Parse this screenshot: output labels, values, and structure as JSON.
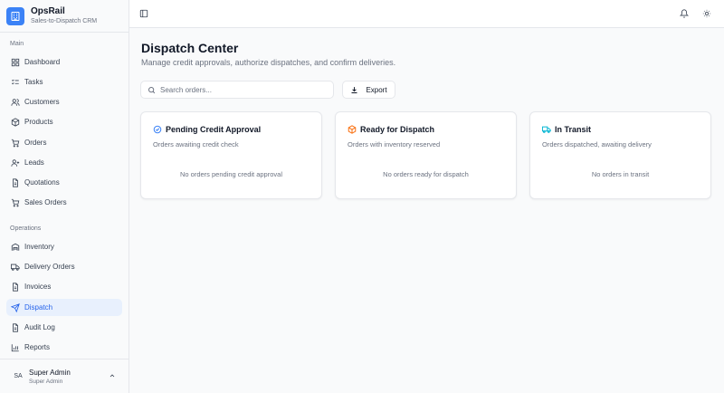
{
  "brand": {
    "name": "OpsRail",
    "subtitle": "Sales-to-Dispatch CRM"
  },
  "sidebar": {
    "sections": [
      {
        "label": "Main",
        "items": [
          {
            "label": "Dashboard",
            "icon": "dashboard-icon"
          },
          {
            "label": "Tasks",
            "icon": "tasks-icon"
          },
          {
            "label": "Customers",
            "icon": "customers-icon"
          },
          {
            "label": "Products",
            "icon": "box-icon"
          },
          {
            "label": "Orders",
            "icon": "cart-icon"
          },
          {
            "label": "Leads",
            "icon": "user-plus-icon"
          },
          {
            "label": "Quotations",
            "icon": "document-icon"
          },
          {
            "label": "Sales Orders",
            "icon": "cart-icon"
          }
        ]
      },
      {
        "label": "Operations",
        "items": [
          {
            "label": "Inventory",
            "icon": "warehouse-icon"
          },
          {
            "label": "Delivery Orders",
            "icon": "truck-icon"
          },
          {
            "label": "Invoices",
            "icon": "document-icon"
          },
          {
            "label": "Dispatch",
            "icon": "send-icon",
            "active": true
          },
          {
            "label": "Audit Log",
            "icon": "document-icon"
          },
          {
            "label": "Reports",
            "icon": "bar-chart-icon"
          }
        ]
      }
    ]
  },
  "user": {
    "initials": "SA",
    "name": "Super Admin",
    "role": "Super Admin"
  },
  "page": {
    "title": "Dispatch Center",
    "subtitle": "Manage credit approvals, authorize dispatches, and confirm deliveries."
  },
  "search": {
    "placeholder": "Search orders...",
    "value": ""
  },
  "toolbar": {
    "export_label": "Export"
  },
  "cards": [
    {
      "title": "Pending Credit Approval",
      "subtitle": "Orders awaiting credit check",
      "empty": "No orders pending credit approval",
      "icon": "check-circle-icon",
      "color": "#3b82f6"
    },
    {
      "title": "Ready for Dispatch",
      "subtitle": "Orders with inventory reserved",
      "empty": "No orders ready for dispatch",
      "icon": "package-icon",
      "color": "#f97316"
    },
    {
      "title": "In Transit",
      "subtitle": "Orders dispatched, awaiting delivery",
      "empty": "No orders in transit",
      "icon": "truck-icon",
      "color": "#06b6d4"
    }
  ],
  "colors": {
    "accent": "#2563eb",
    "active_bg": "#e8f0fd",
    "logo": "#3b82f6"
  }
}
